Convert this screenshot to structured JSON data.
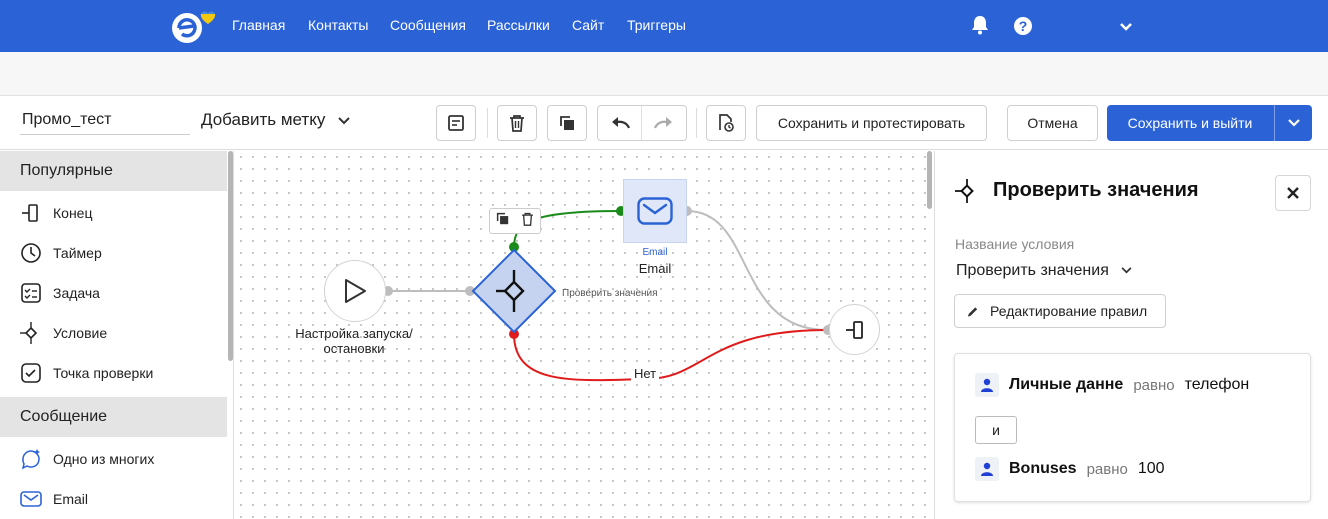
{
  "nav": {
    "items": [
      "Главная",
      "Контакты",
      "Сообщения",
      "Рассылки",
      "Сайт",
      "Триггеры"
    ]
  },
  "toolbar": {
    "campaign_name": "Промо_тест",
    "add_tag": "Добавить метку",
    "save_and_test": "Сохранить и протестировать",
    "cancel": "Отмена",
    "save_and_exit": "Сохранить и выйти"
  },
  "palette": {
    "sections": [
      {
        "title": "Популярные",
        "items": [
          {
            "label": "Конец",
            "icon": "end-icon"
          },
          {
            "label": "Таймер",
            "icon": "timer-icon"
          },
          {
            "label": "Задача",
            "icon": "task-icon"
          },
          {
            "label": "Условие",
            "icon": "condition-icon"
          },
          {
            "label": "Точка проверки",
            "icon": "checkpoint-icon"
          }
        ]
      },
      {
        "title": "Сообщение",
        "items": [
          {
            "label": "Одно из многих",
            "icon": "one-of-many-icon"
          },
          {
            "label": "Email",
            "icon": "email-icon"
          }
        ]
      }
    ]
  },
  "canvas": {
    "start_node_label": "Настройка запуска/остановки",
    "condition_node_label": "Проверить значения",
    "email_node_type": "Email",
    "email_node_label": "Email",
    "no_branch_label": "Нет"
  },
  "panel": {
    "title": "Проверить значения",
    "field_label": "Название условия",
    "condition_value": "Проверить значения",
    "edit_rules": "Редактирование правил",
    "rules": [
      {
        "field": "Личные данне",
        "operator": "равно",
        "value": "телефон"
      },
      {
        "field": "Bonuses",
        "operator": "равно",
        "value": "100"
      }
    ],
    "join": "и"
  },
  "colors": {
    "brand_blue": "#2b63d6",
    "yes_edge": "#1a8a1a",
    "no_edge": "#e01b1b",
    "condition_fill": "#c5d3f0"
  }
}
